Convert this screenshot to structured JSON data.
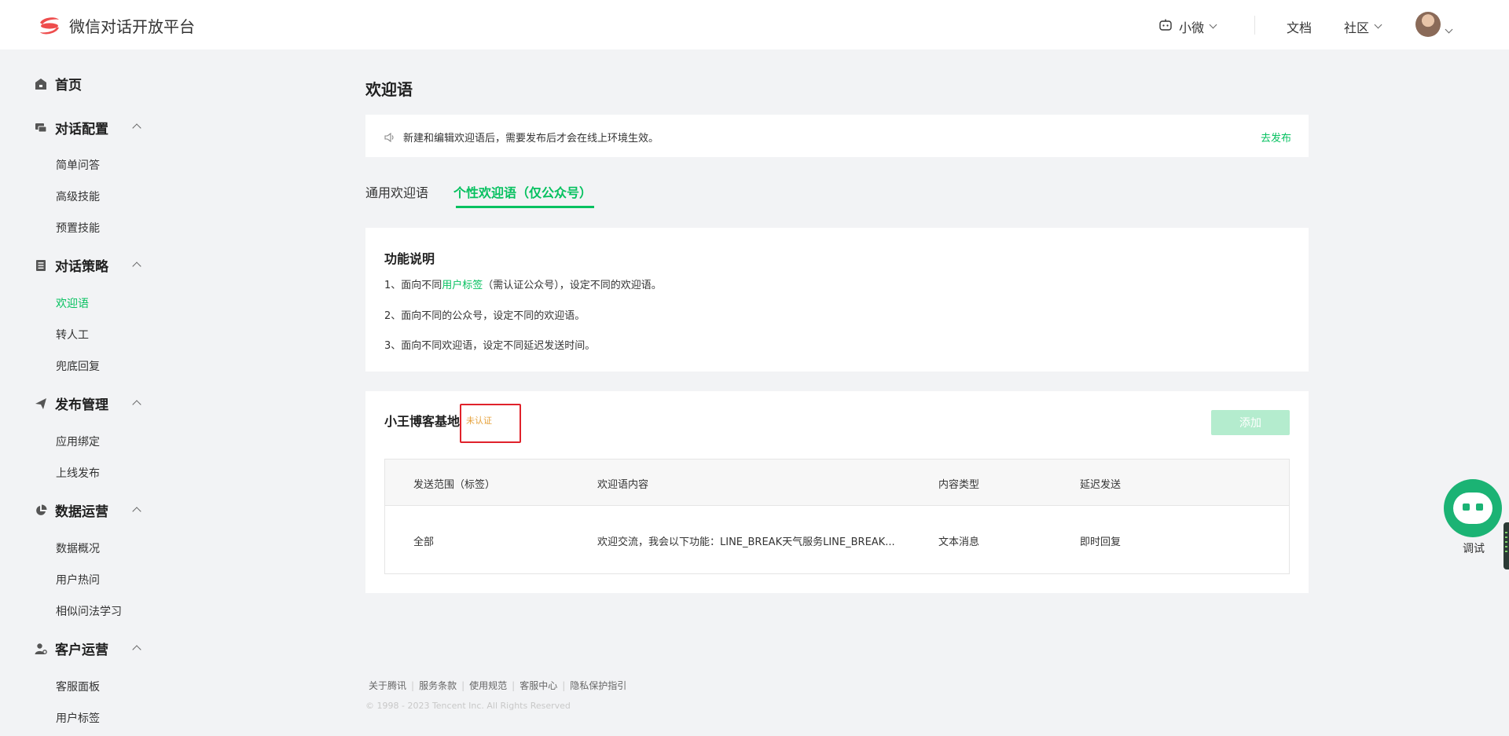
{
  "header": {
    "logo_text": "微信对话开放平台",
    "bot_name": "小微",
    "docs": "文档",
    "community": "社区"
  },
  "sidebar": {
    "home": "首页",
    "groups": [
      {
        "label": "对话配置",
        "items": [
          "简单问答",
          "高级技能",
          "预置技能"
        ]
      },
      {
        "label": "对话策略",
        "items": [
          "欢迎语",
          "转人工",
          "兜底回复"
        ]
      },
      {
        "label": "发布管理",
        "items": [
          "应用绑定",
          "上线发布"
        ]
      },
      {
        "label": "数据运营",
        "items": [
          "数据概况",
          "用户热问",
          "相似问法学习"
        ]
      },
      {
        "label": "客户运营",
        "items": [
          "客服面板",
          "用户标签"
        ]
      }
    ],
    "active_item": "欢迎语"
  },
  "main": {
    "title": "欢迎语",
    "notice": {
      "text": "新建和编辑欢迎语后，需要发布后才会在线上环境生效。",
      "link": "去发布"
    },
    "tabs": [
      {
        "label": "通用欢迎语",
        "active": false
      },
      {
        "label": "个性欢迎语（仅公众号）",
        "active": true
      }
    ],
    "features": {
      "title": "功能说明",
      "line1_prefix": "1、面向不同",
      "line1_link": "用户标签",
      "line1_suffix": "（需认证公众号），设定不同的欢迎语。",
      "line2": "2、面向不同的公众号，设定不同的欢迎语。",
      "line3": "3、面向不同欢迎语，设定不同延迟发送时间。"
    },
    "account": {
      "name": "小王博客基地",
      "badge": "未认证",
      "add_button": "添加"
    },
    "table": {
      "headers": [
        "发送范围（标签）",
        "欢迎语内容",
        "内容类型",
        "延迟发送"
      ],
      "rows": [
        [
          "全部",
          "欢迎交流，我会以下功能：LINE_BREAK天气服务LINE_BREAK...",
          "文本消息",
          "即时回复"
        ]
      ]
    }
  },
  "footer": {
    "links": [
      "关于腾讯",
      "服务条款",
      "使用规范",
      "客服中心",
      "隐私保护指引"
    ],
    "copyright": "© 1998 - 2023 Tencent Inc. All Rights Reserved"
  },
  "debug_widget": {
    "label": "调试"
  },
  "colors": {
    "brand_green": "#07c160",
    "warning_orange": "#e6a23c",
    "highlight_red": "#e0222b"
  }
}
